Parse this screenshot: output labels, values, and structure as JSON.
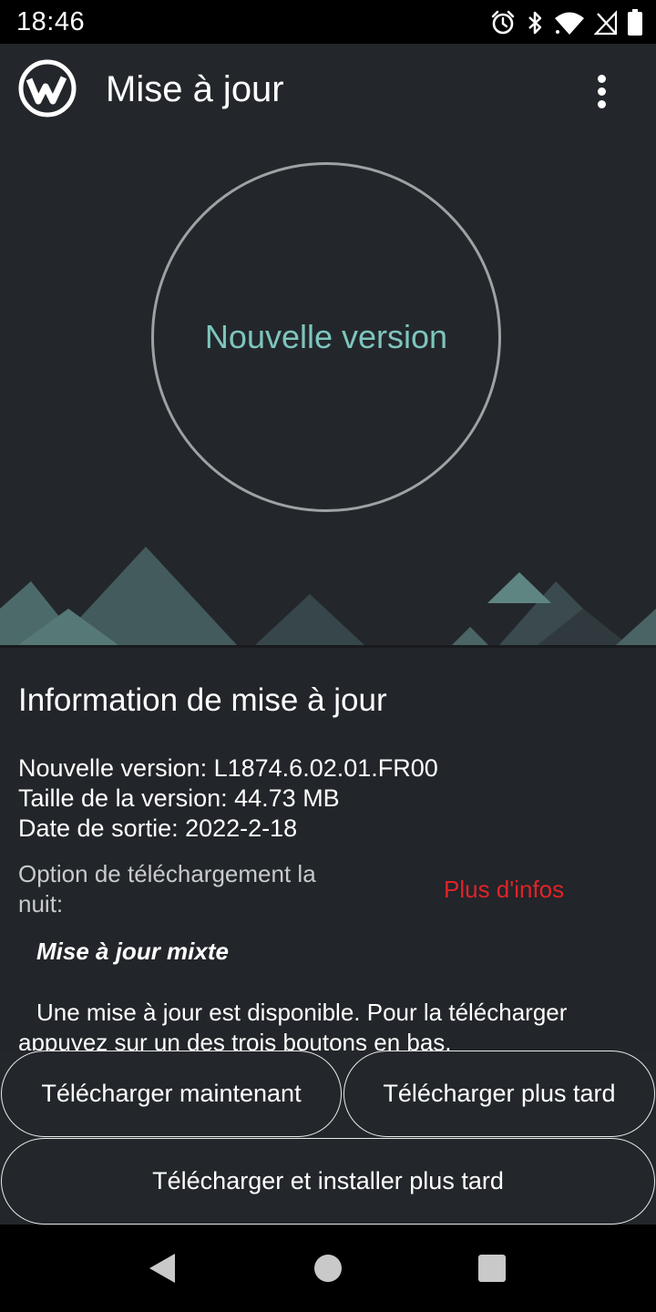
{
  "status_bar": {
    "time": "18:46",
    "icons": [
      "alarm-icon",
      "bluetooth-icon",
      "wifi-icon",
      "no-signal-icon",
      "battery-icon"
    ]
  },
  "app_bar": {
    "title": "Mise à jour",
    "logo_icon": "wiko-logo-icon",
    "menu_icon": "more-vert-icon"
  },
  "hero": {
    "circle_label": "Nouvelle version",
    "accent_color": "#7ec5bd"
  },
  "info": {
    "title": "Information de mise à jour",
    "new_version": "Nouvelle version: L1874.6.02.01.FR00",
    "version_size": "Taille de la version: 44.73 MB",
    "release_date": "Date de sortie: 2022-2-18",
    "night_option": "Option de téléchargement la nuit:",
    "more_info_link": "Plus d'infos",
    "more_info_color": "#e0232a",
    "update_type": "Mise à jour mixte",
    "description": "Une mise à jour est disponible. Pour la télécharger appuyez sur un des trois boutons en bas."
  },
  "buttons": {
    "download_now": "Télécharger maintenant",
    "download_later": "Télécharger plus tard",
    "download_install_later": "Télécharger et installer plus tard"
  },
  "nav_bar": {
    "icons": [
      "back-icon",
      "home-icon",
      "recents-icon"
    ]
  }
}
